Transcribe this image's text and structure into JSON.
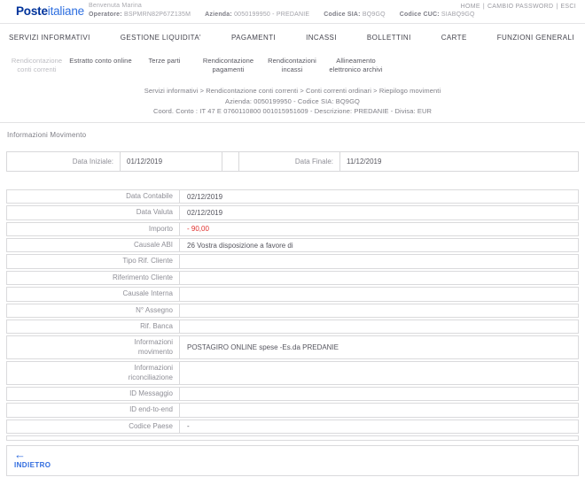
{
  "brand": {
    "logo_bold": "Poste",
    "logo_light": "italiane"
  },
  "header": {
    "welcome": "Benvenuta Marina",
    "fields": [
      {
        "label": "Operatore:",
        "value": "BSPMRN82P67Z135M"
      },
      {
        "label": "Azienda:",
        "value": "0050199950 - PREDANIE"
      },
      {
        "label": "Codice SIA:",
        "value": "BQ9GQ"
      },
      {
        "label": "Codice CUC:",
        "value": "SIABQ9GQ"
      }
    ],
    "links": [
      "HOME",
      "CAMBIO PASSWORD",
      "ESCI"
    ],
    "links_separator": "|"
  },
  "nav": {
    "items": [
      "SERVIZI INFORMATIVI",
      "GESTIONE LIQUIDITA'",
      "PAGAMENTI",
      "INCASSI",
      "BOLLETTINI",
      "CARTE",
      "FUNZIONI GENERALI"
    ]
  },
  "subnav": {
    "items": [
      {
        "label": "Rendicontazione conti correnti",
        "active": true
      },
      {
        "label": "Estratto conto online",
        "active": false
      },
      {
        "label": "Terze parti",
        "active": false
      },
      {
        "label": "Rendicontazione pagamenti",
        "active": false
      },
      {
        "label": "Rendicontazioni incassi",
        "active": false
      },
      {
        "label": "Allineamento elettronico archivi",
        "active": false
      }
    ]
  },
  "breadcrumb": {
    "path": "Servizi informativi > Rendicontazione conti correnti > Conti correnti ordinari > Riepilogo movimenti",
    "line2": "Azienda: 0050199950 - Codice SIA: BQ9GQ",
    "line3": "Coord. Conto : IT 47 E 0760110800 001015951609 - Descrizione: PREDANIE - Divisa: EUR"
  },
  "section_title": "Informazioni Movimento",
  "date_filter": {
    "start_label": "Data Iniziale:",
    "start_value": "01/12/2019",
    "end_label": "Data Finale:",
    "end_value": "11/12/2019"
  },
  "details": {
    "rows": [
      {
        "label": "Data Contabile",
        "value": "02/12/2019"
      },
      {
        "label": "Data Valuta",
        "value": "02/12/2019"
      },
      {
        "label": "Importo",
        "value": "- 90,00",
        "negative": true
      },
      {
        "label": "Causale ABI",
        "value": "26 Vostra disposizione a favore di"
      },
      {
        "label": "Tipo Rif. Cliente",
        "value": ""
      },
      {
        "label": "Riferimento Cliente",
        "value": ""
      },
      {
        "label": "Causale Interna",
        "value": ""
      },
      {
        "label": "N° Assegno",
        "value": ""
      },
      {
        "label": "Rif. Banca",
        "value": ""
      },
      {
        "label": "Informazioni\nmovimento",
        "value": "POSTAGIRO ONLINE spese -Es.da PREDANIE"
      },
      {
        "label": "Informazioni\nriconciliazione",
        "value": ""
      },
      {
        "label": "ID Messaggio",
        "value": ""
      },
      {
        "label": "ID end-to-end",
        "value": ""
      },
      {
        "label": "Codice Paese",
        "value": "-"
      }
    ]
  },
  "footer": {
    "back_icon": "←",
    "back_label": "INDIETRO"
  },
  "colors": {
    "brand_dark_blue": "#00339b",
    "brand_light_blue": "#2e6fe0",
    "link_blue": "#2f6bdf",
    "negative_red": "#e0302d",
    "label_gray": "#8f8f97",
    "value_gray": "#55555e",
    "border_gray": "#dadadc"
  }
}
